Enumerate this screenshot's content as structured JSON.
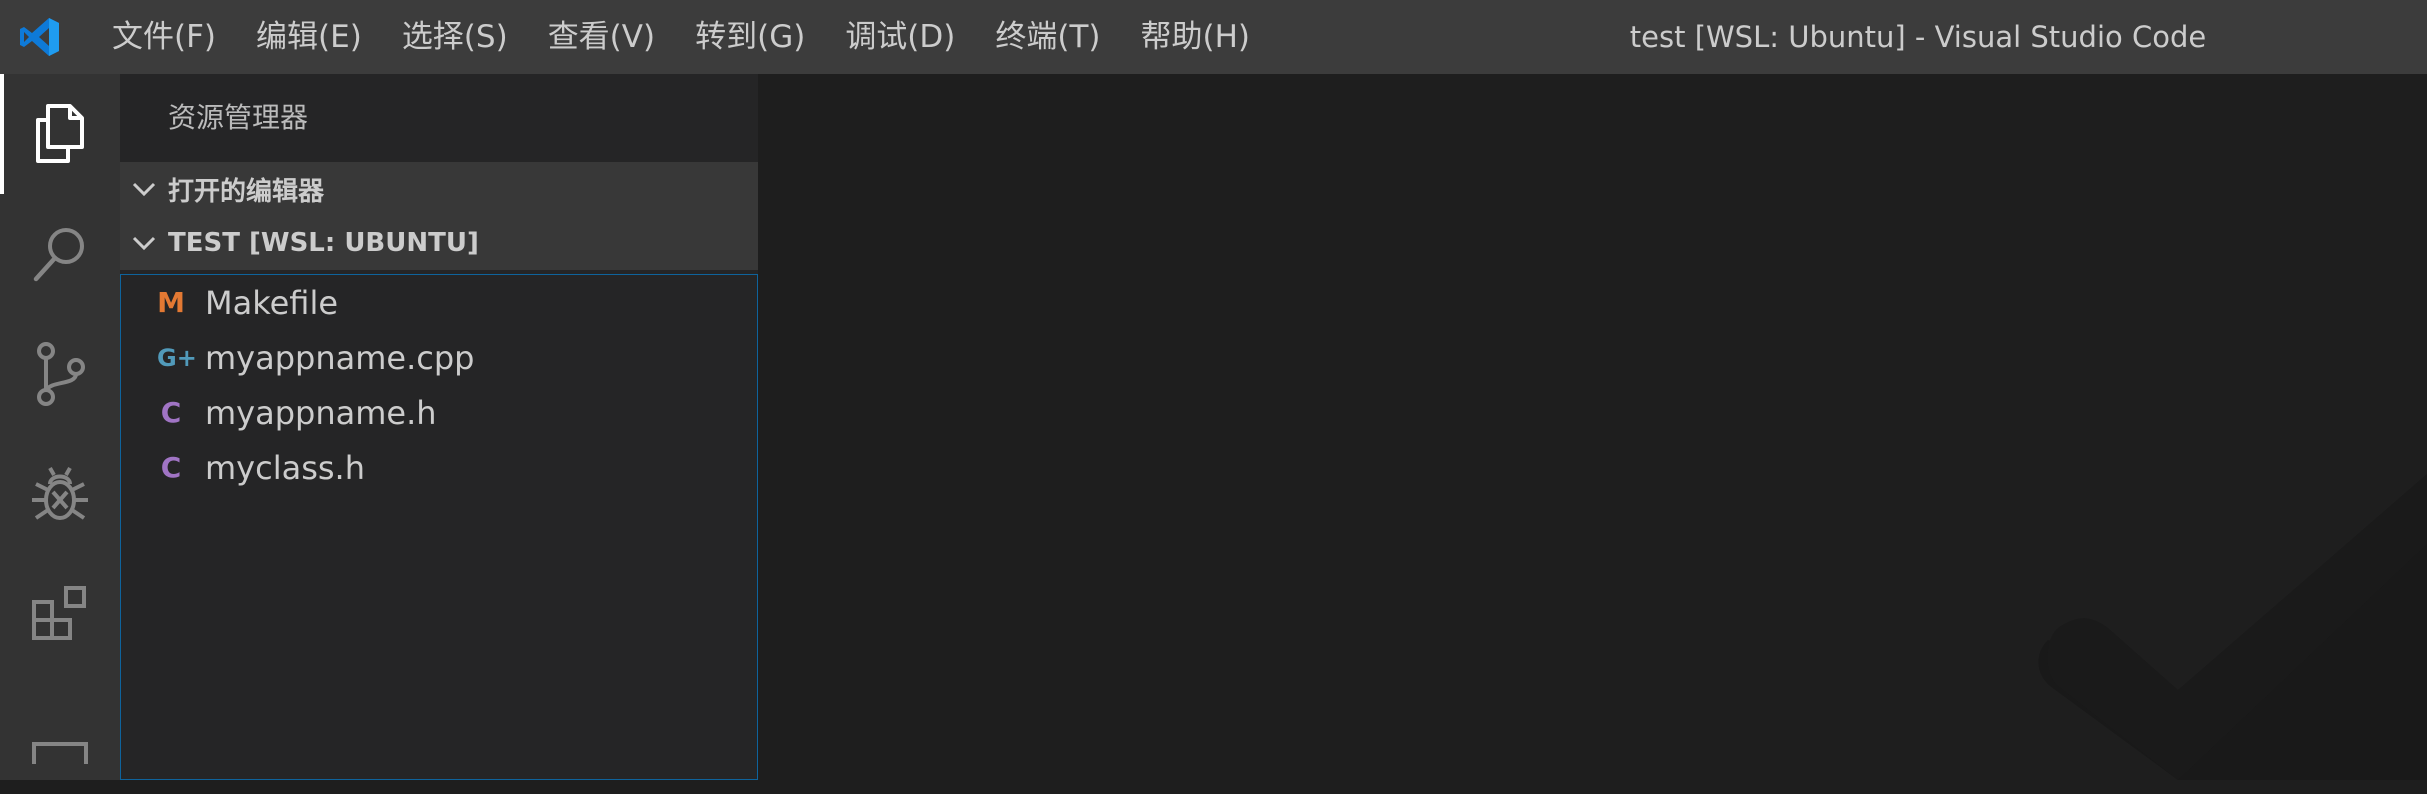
{
  "menubar": {
    "items": [
      "文件(F)",
      "编辑(E)",
      "选择(S)",
      "查看(V)",
      "转到(G)",
      "调试(D)",
      "终端(T)",
      "帮助(H)"
    ]
  },
  "window": {
    "title": "test [WSL: Ubuntu] - Visual Studio Code"
  },
  "activitybar": {
    "items": [
      "explorer-icon",
      "search-icon",
      "source-control-icon",
      "debug-icon",
      "extensions-icon",
      "remote-explorer-icon"
    ],
    "active": "explorer-icon"
  },
  "sidebar": {
    "title": "资源管理器",
    "sections": [
      {
        "label": "打开的编辑器"
      },
      {
        "label": "TEST [WSL: UBUNTU]"
      }
    ],
    "files": [
      {
        "name": "Makefile",
        "icon": "M",
        "icon_color": "#e37933"
      },
      {
        "name": "myappname.cpp",
        "icon": "G+",
        "icon_color": "#519aba"
      },
      {
        "name": "myappname.h",
        "icon": "C",
        "icon_color": "#a074c4"
      },
      {
        "name": "myclass.h",
        "icon": "C",
        "icon_color": "#a074c4"
      }
    ]
  },
  "colors": {
    "titlebar": "#3c3c3c",
    "activitybar": "#333333",
    "sidebar": "#252526",
    "section_header": "#383838",
    "editor": "#1e1e1e",
    "focus_border": "#0e639c",
    "vscode_blue": "#0e7ad8"
  }
}
